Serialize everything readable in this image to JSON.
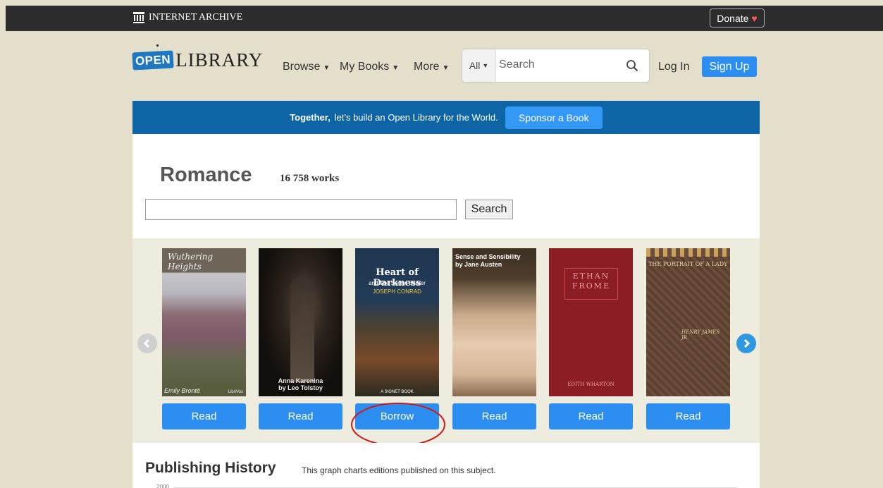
{
  "ia_bar": {
    "logo_text": "INTERNET ARCHIVE",
    "donate_label": "Donate",
    "donate_heart": "♥"
  },
  "header": {
    "logo_open": "OPEN",
    "logo_library": "LIBRARY",
    "nav": [
      {
        "label": "Browse",
        "icon": "caret-down-icon"
      },
      {
        "label": "My Books",
        "icon": "caret-down-icon"
      },
      {
        "label": "More",
        "icon": "caret-down-icon"
      }
    ],
    "search_scope": "All",
    "search_placeholder": "Search",
    "login_label": "Log In",
    "signup_label": "Sign Up"
  },
  "banner": {
    "bold": "Together,",
    "text": "let's build an Open Library for the World.",
    "button": "Sponsor a Book"
  },
  "subject": {
    "title": "Romance",
    "count": "16 758 works",
    "search_value": "",
    "search_button": "Search"
  },
  "carousel": {
    "books": [
      {
        "cover_title": "Wuthering Heights",
        "cover_author": "Emily Brontë",
        "cover_publisher": "LibriVox",
        "action": "Read"
      },
      {
        "cover_title": "Anna Karenina",
        "cover_author": "by Leo Tolstoy",
        "action": "Read"
      },
      {
        "cover_title": "Heart of Darkness",
        "cover_subtitle": "and The Secret Sharer",
        "cover_author": "JOSEPH CONRAD",
        "cover_publisher": "A SIGNET BOOK",
        "action": "Borrow"
      },
      {
        "cover_title": "Sense and Sensibility",
        "cover_author": "by Jane Austen",
        "action": "Read"
      },
      {
        "cover_title": "ETHAN FROME",
        "cover_author": "EDITH WHARTON",
        "action": "Read"
      },
      {
        "cover_title": "THE PORTRAIT OF A LADY",
        "cover_author": "HENRY JAMES JR.",
        "action": "Read"
      }
    ]
  },
  "history": {
    "title": "Publishing History",
    "subtitle": "This graph charts editions published on this subject.",
    "axis_label": "2000"
  },
  "colors": {
    "accent": "#2b8ef0",
    "banner": "#0d65a6",
    "page_bg": "#e3dfcb"
  }
}
